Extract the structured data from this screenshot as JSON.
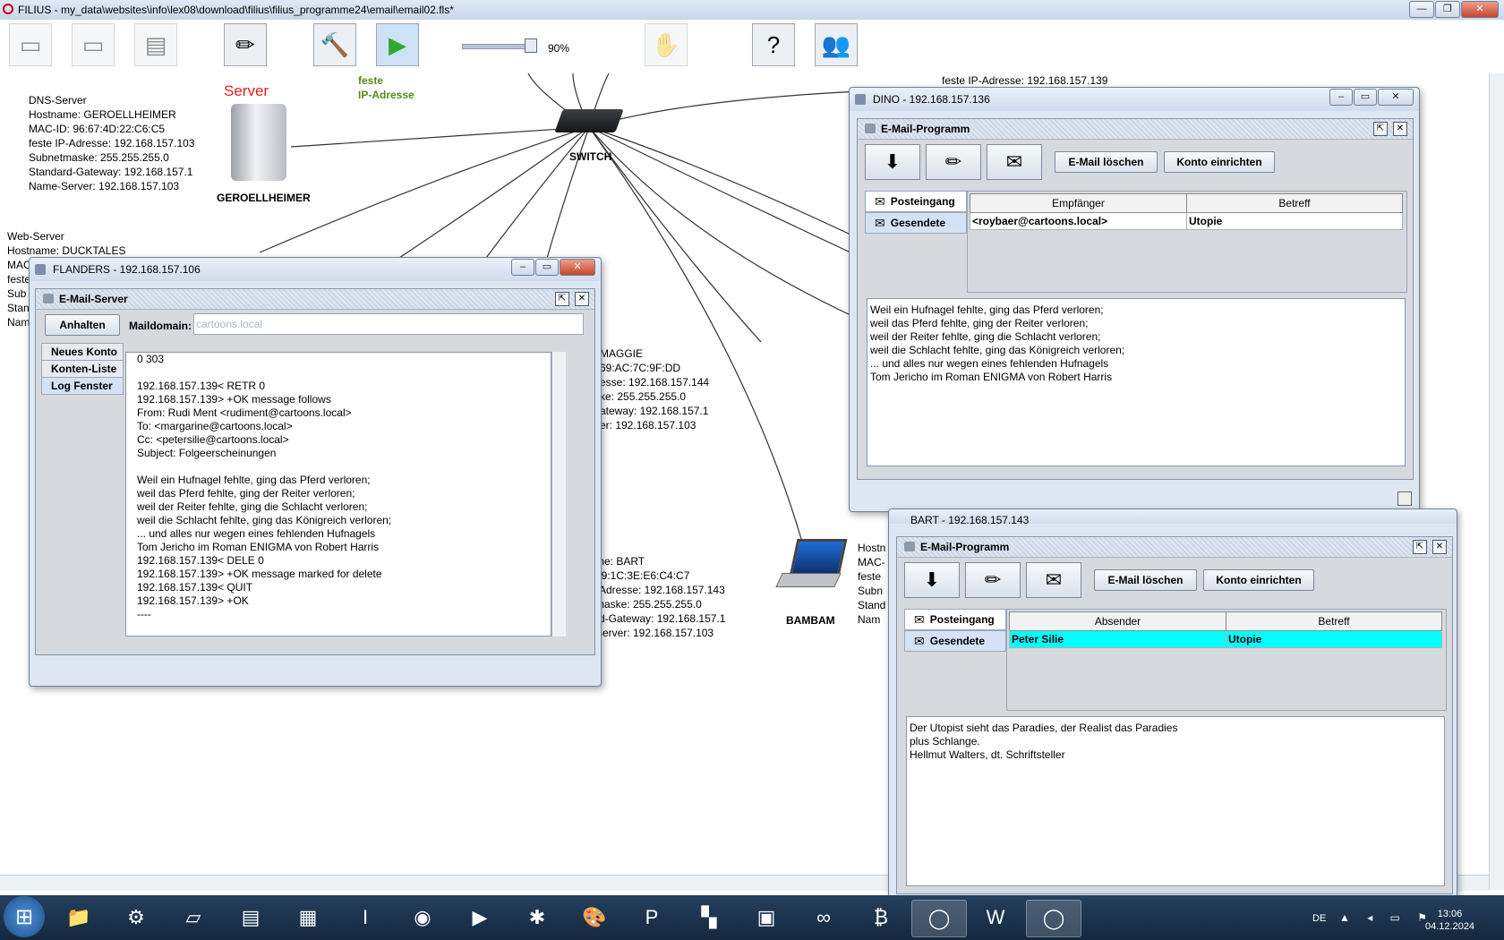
{
  "app": {
    "title": "FILIUS - my_data\\websites\\info\\lex08\\download\\filius\\filius_programme24\\email\\email02.fls*",
    "window_controls": [
      "—",
      "❐",
      "✕"
    ]
  },
  "toolbar": {
    "zoom": "90%",
    "icons": [
      "new-icon",
      "open-icon",
      "save-icon",
      "edit-mode-icon",
      "build-mode-icon",
      "run-simulation-icon",
      "disabled-icon",
      "help-icon",
      "info-icon"
    ]
  },
  "canvas": {
    "dns_server": {
      "label": "Server",
      "name": "GEROELLHEIMER",
      "info": "DNS-Server\nHostname: GEROELLHEIMER\nMAC-ID: 96:67:4D:22:C6:C5\nfeste IP-Adresse: 192.168.157.103\nSubnetmaske: 255.255.255.0\nStandard-Gateway: 192.168.157.1\nName-Server: 192.168.157.103"
    },
    "feste_ip_label": "feste\nIP-Adresse",
    "switch_label": "SWITCH",
    "web_server_info": "Web-Server\nHostname: DUCKTALES\nMAC\nfeste\nSub\nStan\nNam",
    "maggie_info": "MAGGIE\n69:AC:7C:9F:DD\nesse: 192.168.157.144\nke: 255.255.255.0\nateway: 192.168.157.1\ner: 192.168.157.103",
    "bart_info": "me: BART\n39:1C:3E:E6:C4:C7\n-Adresse: 192.168.157.143\nmaske: 255.255.255.0\nrd-Gateway: 192.168.157.1\nServer: 192.168.157.103",
    "bambam_label": "BAMBAM",
    "bambam_info": "Hostn\nMAC-\nfeste\nSubn\nStand\nNam",
    "top_partial": "feste IP-Adresse: 192.168.157.139"
  },
  "flanders": {
    "title": "FLANDERS - 192.168.157.106",
    "inner_title": "E-Mail-Server",
    "stop_button": "Anhalten",
    "maildomain_label": "Maildomain:",
    "maildomain_value": "cartoons.local",
    "tabs": [
      "Neues Konto",
      "Konten-Liste",
      "Log Fenster"
    ],
    "log_lines": "0 303\n\n192.168.157.139< RETR 0\n192.168.157.139> +OK message follows\nFrom: Rudi Ment <rudiment@cartoons.local>\nTo: <margarine@cartoons.local>\nCc: <petersilie@cartoons.local>\nSubject: Folgeerscheinungen\n\nWeil ein Hufnagel fehlte, ging das Pferd verloren;\nweil das Pferd fehlte, ging der Reiter verloren;\nweil der Reiter fehlte, ging die Schlacht verloren;\nweil die Schlacht fehlte, ging das Königreich verloren;\n... und alles nur wegen eines fehlenden Hufnagels\nTom Jericho im Roman ENIGMA von Robert Harris\n192.168.157.139< DELE 0\n192.168.157.139> +OK message marked for delete\n192.168.157.139< QUIT\n192.168.157.139> +OK\n----"
  },
  "dino": {
    "title": "DINO - 192.168.157.136",
    "inner_title": "E-Mail-Programm",
    "delete_button": "E-Mail löschen",
    "account_button": "Konto einrichten",
    "tabs": [
      "Posteingang",
      "Gesendete"
    ],
    "table": {
      "headers": [
        "Empfänger",
        "Betreff"
      ],
      "rows": [
        [
          "<roybaer@cartoons.local>",
          "Utopie"
        ]
      ]
    },
    "body": "Weil ein Hufnagel fehlte, ging das Pferd verloren;\nweil das Pferd fehlte, ging der Reiter verloren;\nweil der Reiter fehlte, ging die Schlacht verloren;\nweil die Schlacht fehlte, ging das Königreich verloren;\n... und alles nur wegen eines fehlenden Hufnagels\nTom Jericho im Roman ENIGMA von Robert Harris"
  },
  "bart": {
    "title": "BART - 192.168.157.143",
    "inner_title": "E-Mail-Programm",
    "delete_button": "E-Mail löschen",
    "account_button": "Konto einrichten",
    "tabs": [
      "Posteingang",
      "Gesendete"
    ],
    "table": {
      "headers": [
        "Absender",
        "Betreff"
      ],
      "rows": [
        [
          "Peter Silie",
          "Utopie"
        ]
      ]
    },
    "selected_row_color": "#00ffff",
    "body": "Der Utopist sieht das Paradies, der Realist das Paradies\nplus Schlange.\nHellmut Walters, dt. Schriftsteller"
  },
  "taskbar": {
    "language": "DE",
    "time": "13:06",
    "date": "04.12.2024",
    "items": [
      "📁",
      "⚙",
      "▱",
      "▤",
      "▦",
      "I",
      "◉",
      "▶",
      "✱",
      "🎨",
      "P",
      "▚",
      "▣",
      "∞",
      "₿",
      "◯",
      "W",
      "◯"
    ]
  },
  "colors": {
    "server_label": "#e02020",
    "feste_label": "#5a8a1a",
    "accent": "#00ffff"
  }
}
